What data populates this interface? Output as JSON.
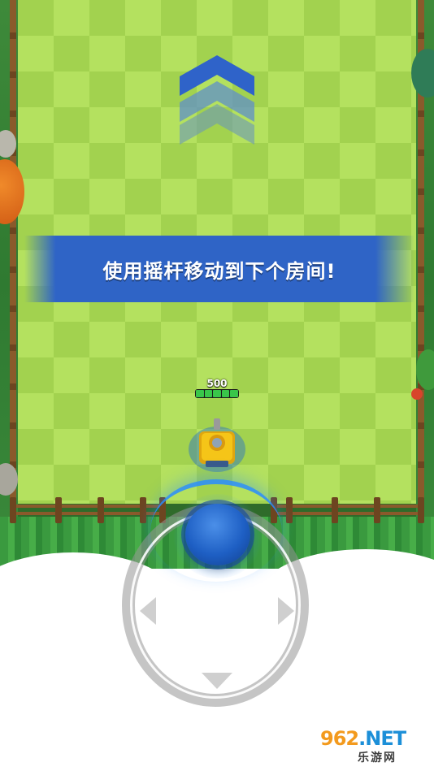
{
  "banner": {
    "text": "使用摇杆移动到下个房间!"
  },
  "tank": {
    "hp_value": "500",
    "hp_fraction": 1.0,
    "body_color": "#f5c518",
    "aura_color": "#3a7fd8"
  },
  "direction_hint": {
    "icon": "up-chevrons-icon",
    "color": "#2f63c9"
  },
  "joystick": {
    "knob_color": "#1e5fc4",
    "arrows": [
      "left-arrow-icon",
      "right-arrow-icon",
      "down-arrow-icon"
    ]
  },
  "watermark": {
    "top_digits": "962",
    "top_suffix": ".NET",
    "sub": "乐游网"
  },
  "colors": {
    "field_light": "#b4e15f",
    "field_dark": "#a2d24f",
    "banner": "#2f64c6",
    "watermark_orange": "#f39a1d",
    "watermark_blue": "#1c8fd8"
  }
}
